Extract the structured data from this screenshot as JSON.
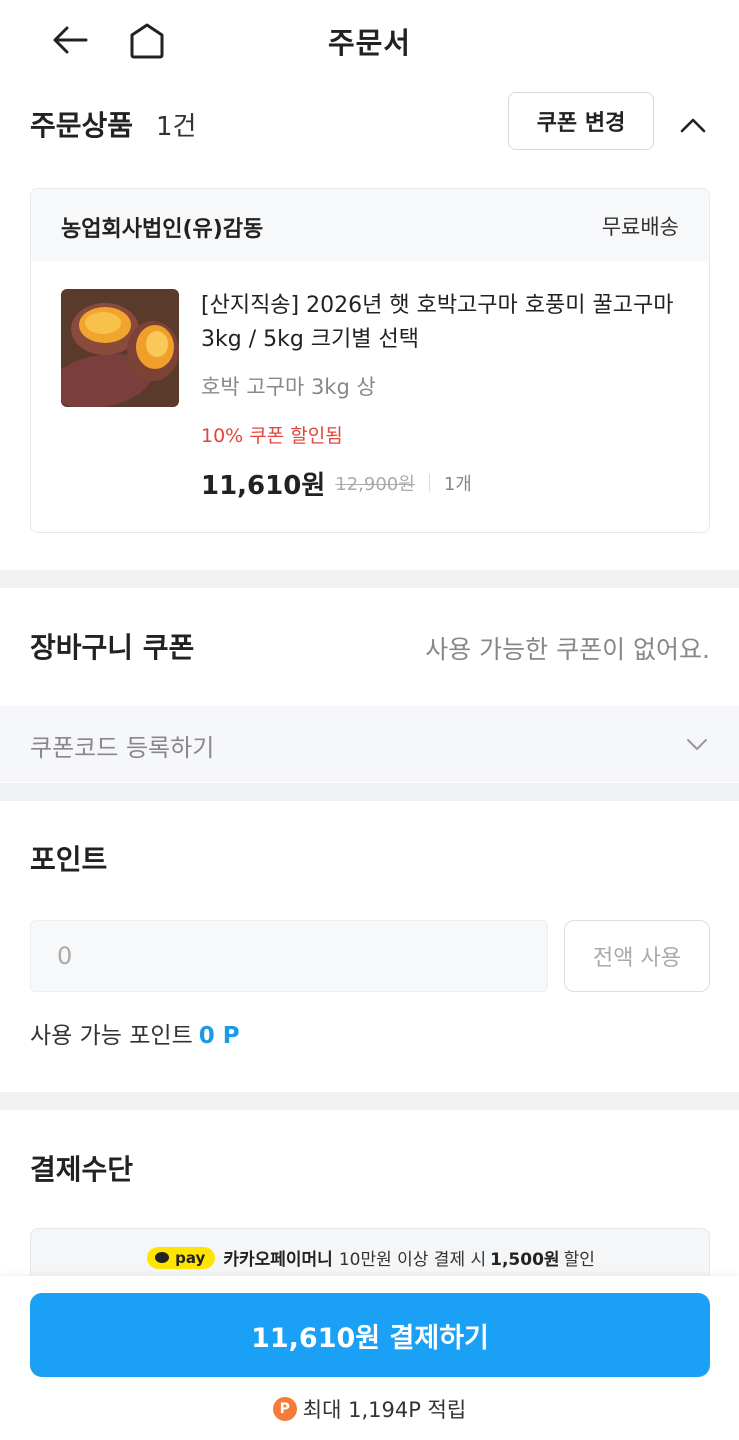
{
  "header": {
    "title": "주문서",
    "back_icon": "arrow-left-icon",
    "home_icon": "home-icon"
  },
  "order_section": {
    "title": "주문상품",
    "count": "1건",
    "coupon_change_label": "쿠폰 변경",
    "collapse_icon": "chevron-up-icon"
  },
  "order_card": {
    "seller": "농업회사법인(유)감동",
    "shipping": "무료배송",
    "product": {
      "name": "[산지직송] 2026년 햇 호박고구마 호풍미 꿀고구마 3kg / 5kg 크기별 선택",
      "option": "호박 고구마 3kg 상",
      "coupon_note": "10% 쿠폰 할인됨",
      "price": "11,610원",
      "original_price": "12,900원",
      "quantity": "1개"
    }
  },
  "cart_coupon": {
    "title": "장바구니 쿠폰",
    "message": "사용 가능한 쿠폰이 없어요."
  },
  "coupon_code": {
    "label": "쿠폰코드 등록하기",
    "arrow_icon": "chevron-down-icon"
  },
  "points": {
    "title": "포인트",
    "input_placeholder": "0",
    "use_all_label": "전액 사용",
    "available_label": "사용 가능 포인트",
    "available_value": "0 P"
  },
  "payment": {
    "title": "결제수단",
    "badge": "pay",
    "promo_brand": "카카오페이머니",
    "promo_text_1": "10만원 이상 결제 시",
    "promo_amount": "1,500원",
    "promo_text_2": "할인"
  },
  "bottom": {
    "pay_button": "11,610원 결제하기",
    "reward_icon": "P",
    "reward_text": "최대 1,194P 적립"
  },
  "colors": {
    "accent": "#1aa0f5",
    "discount": "#e0453e",
    "point": "#1a9be8",
    "kakao": "#ffe400"
  }
}
